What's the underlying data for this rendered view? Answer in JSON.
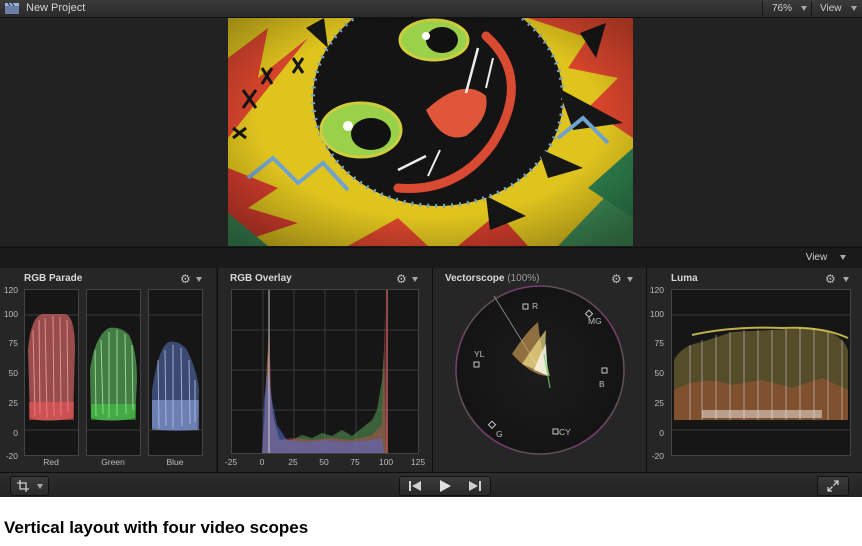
{
  "window": {
    "title": "New Project",
    "zoom": "76%",
    "view_label": "View"
  },
  "scopes_header": {
    "view_label": "View"
  },
  "panels": {
    "rgb_parade": {
      "title": "RGB Parade",
      "y_ticks": [
        "120",
        "100",
        "75",
        "50",
        "25",
        "0",
        "-20"
      ],
      "channels": [
        "Red",
        "Green",
        "Blue"
      ]
    },
    "rgb_overlay": {
      "title": "RGB Overlay",
      "x_ticks": [
        "-25",
        "0",
        "25",
        "50",
        "75",
        "100",
        "125"
      ]
    },
    "vectorscope": {
      "title": "Vectorscope",
      "zoom": "(100%)",
      "targets": [
        "R",
        "MG",
        "B",
        "CY",
        "G",
        "YL"
      ]
    },
    "luma": {
      "title": "Luma",
      "y_ticks": [
        "120",
        "100",
        "75",
        "50",
        "25",
        "0",
        "-20"
      ]
    }
  },
  "caption": "Vertical layout with four video scopes",
  "icons": [
    "clapper-icon",
    "gear-icon",
    "crop-icon",
    "skip-back-icon",
    "play-icon",
    "skip-forward-icon",
    "fullscreen-icon"
  ]
}
